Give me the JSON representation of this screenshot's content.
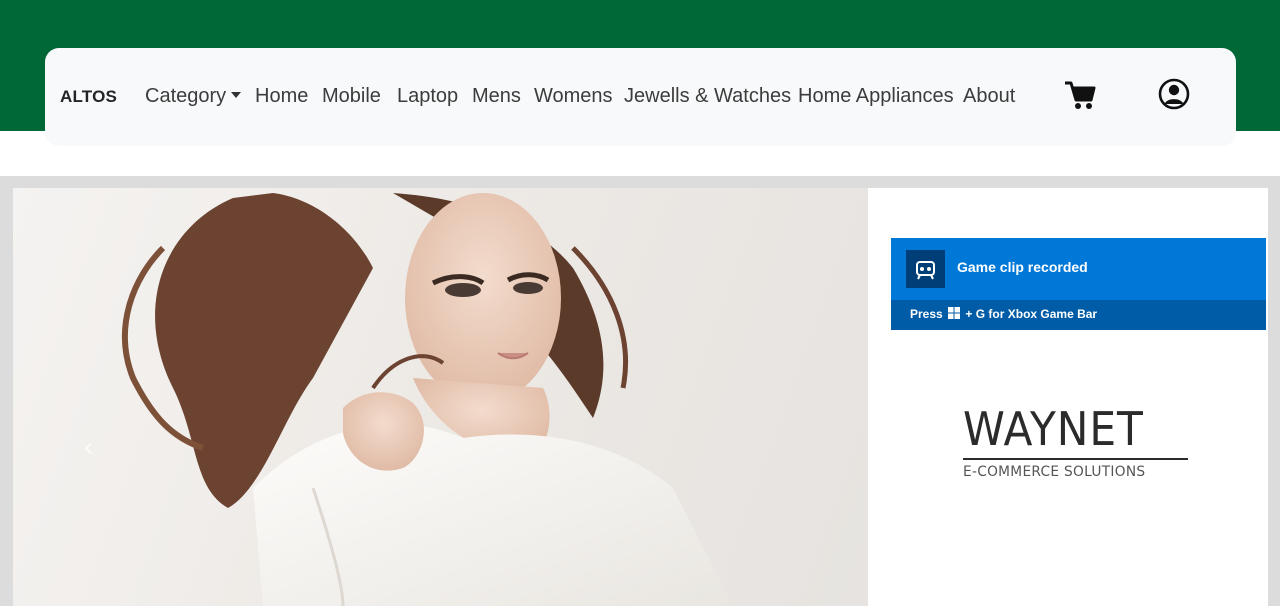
{
  "navbar": {
    "brand": "ALTOS",
    "links": [
      "Category",
      "Home",
      "Mobile",
      "Laptop",
      "Mens",
      "Womens",
      "Jewells & Watches",
      "Home Appliances",
      "About"
    ],
    "icons": {
      "cart": "cart-icon",
      "user": "user-circle-icon"
    }
  },
  "carousel": {
    "prev_glyph": "‹",
    "logo": {
      "main": "WAYNET",
      "sub": "E-COMMERCE SOLUTIONS"
    }
  },
  "toast": {
    "title": "Game clip recorded",
    "hint_prefix": "Press",
    "hint_suffix": "+ G for Xbox Game Bar",
    "icon": "game-bar-capture-icon"
  },
  "colors": {
    "brand_green": "#006837",
    "navbar_bg": "#f8f9fa",
    "toast_blue": "#0078d7",
    "toast_dark": "#005ca6"
  }
}
